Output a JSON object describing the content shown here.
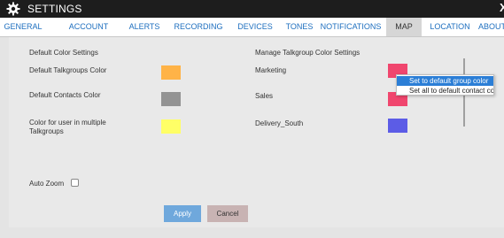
{
  "window": {
    "title": "SETTINGS",
    "close_glyph": "X",
    "icon": "gear-icon"
  },
  "tabs": [
    {
      "label": "GENERAL",
      "active": false
    },
    {
      "label": "ACCOUNT",
      "active": false
    },
    {
      "label": "ALERTS",
      "active": false
    },
    {
      "label": "RECORDING",
      "active": false
    },
    {
      "label": "DEVICES",
      "active": false
    },
    {
      "label": "TONES",
      "active": false
    },
    {
      "label": "NOTIFICATIONS",
      "active": false
    },
    {
      "label": "MAP",
      "active": true
    },
    {
      "label": "LOCATION",
      "active": false
    },
    {
      "label": "ABOUT",
      "active": false
    }
  ],
  "default_colors": {
    "heading": "Default Color Settings",
    "talkgroups": {
      "label": "Default Talkgroups Color",
      "color": "#ffb347"
    },
    "contacts": {
      "label": "Default Contacts Color",
      "color": "#939393"
    },
    "multiple": {
      "label": "Color for user in multiple Talkgroups",
      "color": "#ffff66"
    }
  },
  "talkgroup_colors": {
    "heading": "Manage Talkgroup Color Settings",
    "items": [
      {
        "label": "Marketing",
        "color": "#f0466e"
      },
      {
        "label": "Sales",
        "color": "#f0466e"
      },
      {
        "label": "Delivery_South",
        "color": "#5c5ce6"
      }
    ]
  },
  "auto_zoom": {
    "label": "Auto Zoom",
    "checked": false
  },
  "buttons": {
    "apply": "Apply",
    "cancel": "Cancel"
  },
  "context_menu": {
    "items": [
      {
        "label": "Set to default group color",
        "highlighted": true
      },
      {
        "label": "Set all to default contact color",
        "highlighted": false
      }
    ]
  },
  "colors": {
    "accent": "#1e6fbf",
    "titlebar": "#1d1d1d",
    "apply_button": "#6fa8dc",
    "menu_highlight": "#2b7ed6"
  }
}
